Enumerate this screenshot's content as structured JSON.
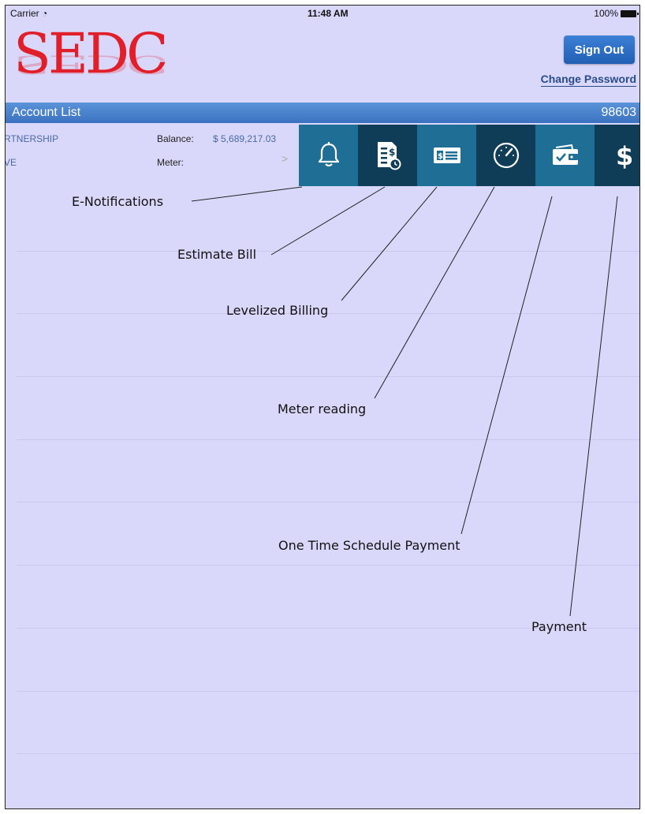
{
  "status_bar": {
    "carrier": "Carrier",
    "time": "11:48 AM",
    "battery": "100%"
  },
  "logo": {
    "text": "SEDC"
  },
  "header": {
    "sign_out": "Sign Out",
    "change_password": "Change Password"
  },
  "account_bar": {
    "title": "Account List",
    "number": "98603"
  },
  "account_row": {
    "name_fragment": "RTNERSHIP",
    "address_fragment": "VE",
    "balance_label": "Balance:",
    "balance_value": "$ 5,689,217.03",
    "meter_label": "Meter:",
    "chevron": ">"
  },
  "actions": [
    {
      "icon": "bell-icon",
      "label": "E-Notifications"
    },
    {
      "icon": "estimate-bill-icon",
      "label": "Estimate Bill"
    },
    {
      "icon": "levelized-billing-icon",
      "label": "Levelized Billing"
    },
    {
      "icon": "meter-gauge-icon",
      "label": "Meter reading"
    },
    {
      "icon": "wallet-check-icon",
      "label": "One Time Schedule Payment"
    },
    {
      "icon": "dollar-icon",
      "label": "Payment"
    }
  ],
  "colors": {
    "background": "#d9d8fb",
    "logo": "#e11f2a",
    "action_light": "#1e6e96",
    "action_dark": "#0f3d57",
    "header_bar": "#4a82cc"
  }
}
